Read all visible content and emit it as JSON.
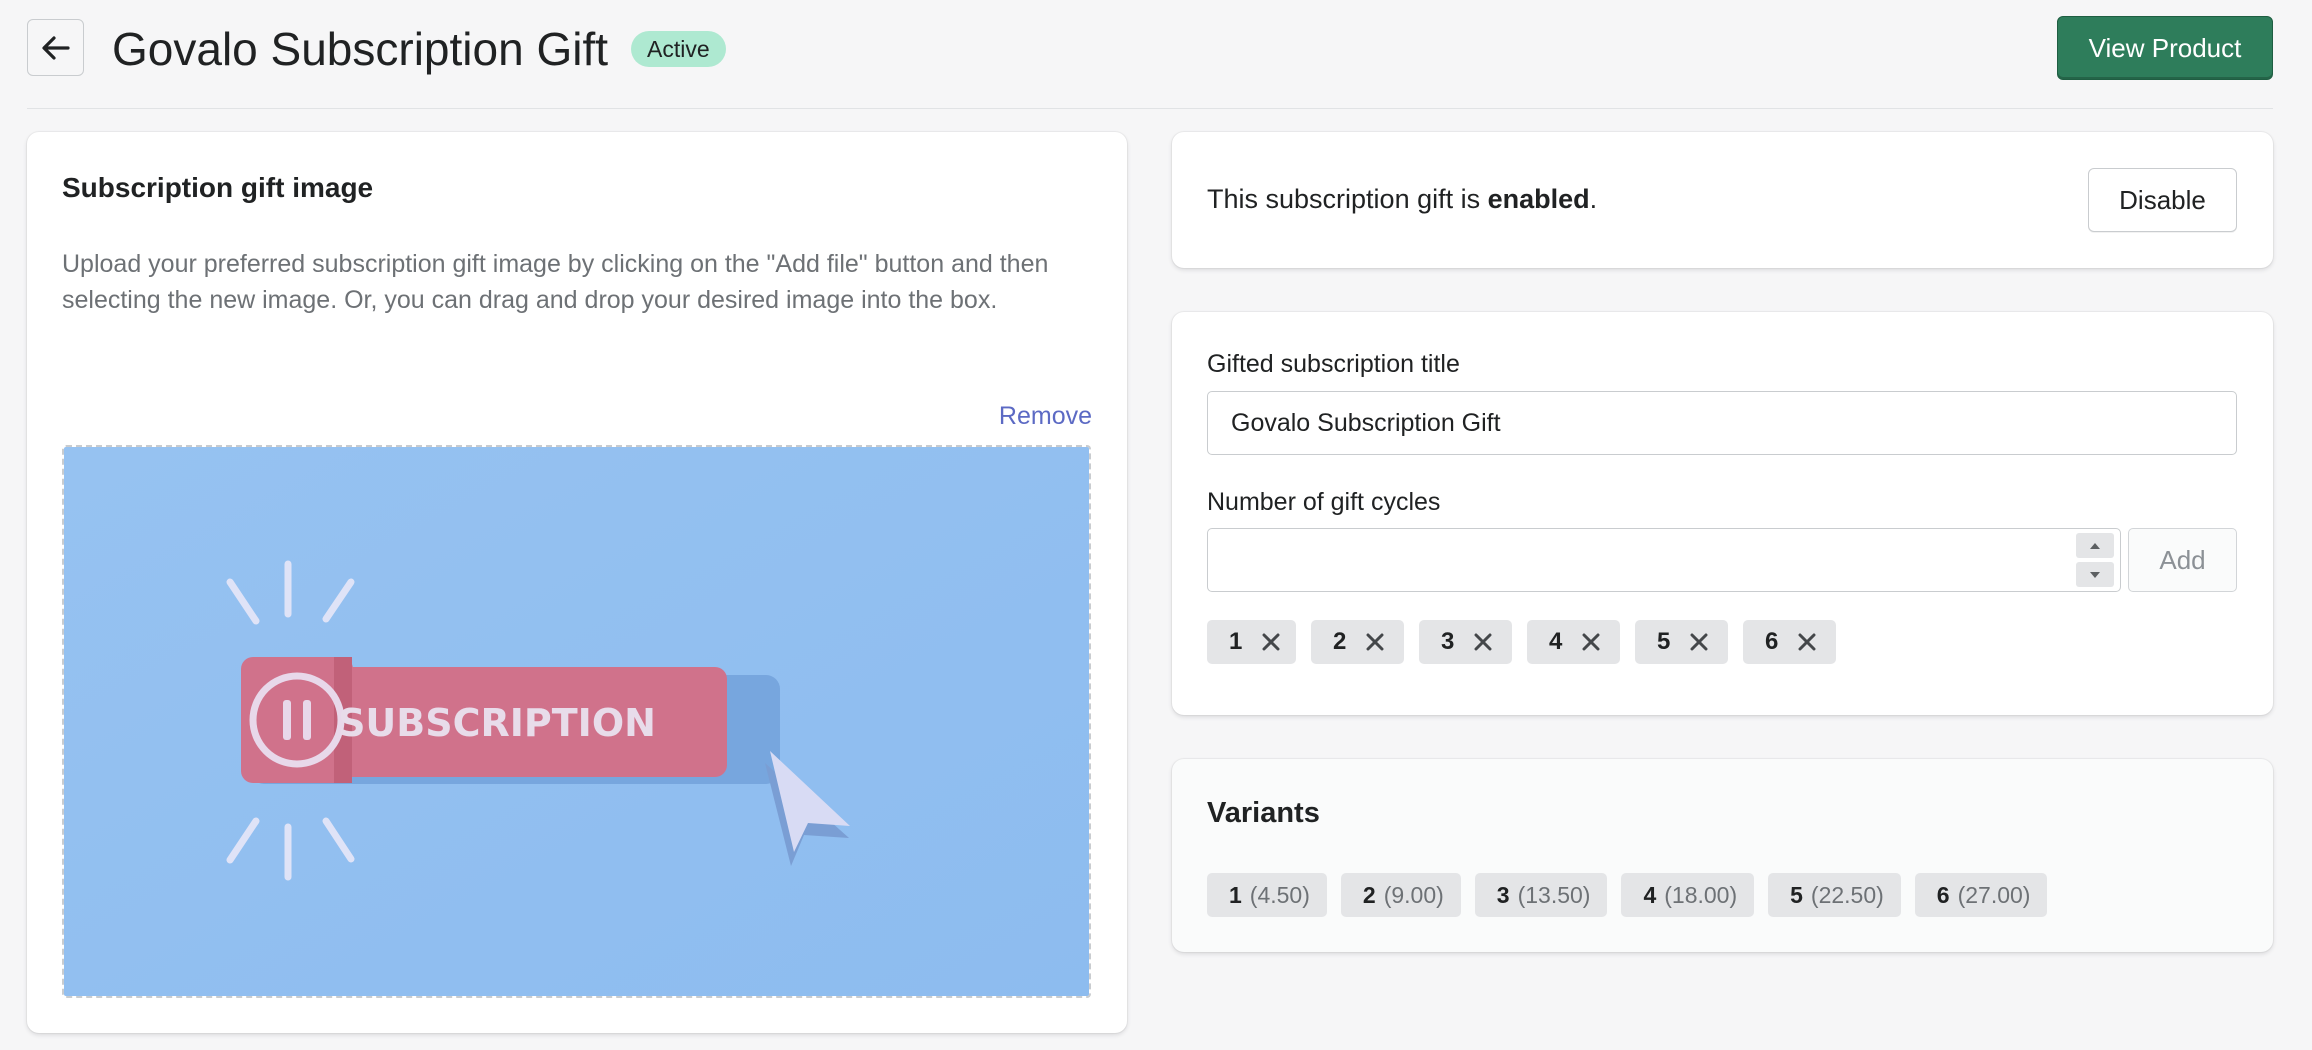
{
  "header": {
    "title": "Govalo Subscription Gift",
    "status": "Active",
    "view_button": "View Product",
    "back_icon": "arrow-left-icon"
  },
  "image_card": {
    "heading": "Subscription gift image",
    "description": "Upload your preferred subscription gift image by clicking on the \"Add file\" button and then selecting the new image. Or, you can drag and drop your desired image into the box.",
    "remove_label": "Remove",
    "image_text": "SUBSCRIPTION"
  },
  "status_card": {
    "prefix": "This subscription gift is ",
    "state": "enabled",
    "suffix": ".",
    "disable_button": "Disable"
  },
  "form_card": {
    "title_label": "Gifted subscription title",
    "title_value": "Govalo Subscription Gift",
    "cycles_label": "Number of gift cycles",
    "cycles_value": "",
    "add_button": "Add",
    "cycles": [
      "1",
      "2",
      "3",
      "4",
      "5",
      "6"
    ]
  },
  "variants_card": {
    "heading": "Variants",
    "items": [
      {
        "num": "1",
        "price": "(4.50)"
      },
      {
        "num": "2",
        "price": "(9.00)"
      },
      {
        "num": "3",
        "price": "(13.50)"
      },
      {
        "num": "4",
        "price": "(18.00)"
      },
      {
        "num": "5",
        "price": "(22.50)"
      },
      {
        "num": "6",
        "price": "(27.00)"
      }
    ]
  },
  "colors": {
    "primary": "#2e7d5b",
    "badge_success": "#aee9d1",
    "link": "#5c6ac4",
    "image_bg": "#92bff0",
    "subscription_button": "#d0728b"
  }
}
